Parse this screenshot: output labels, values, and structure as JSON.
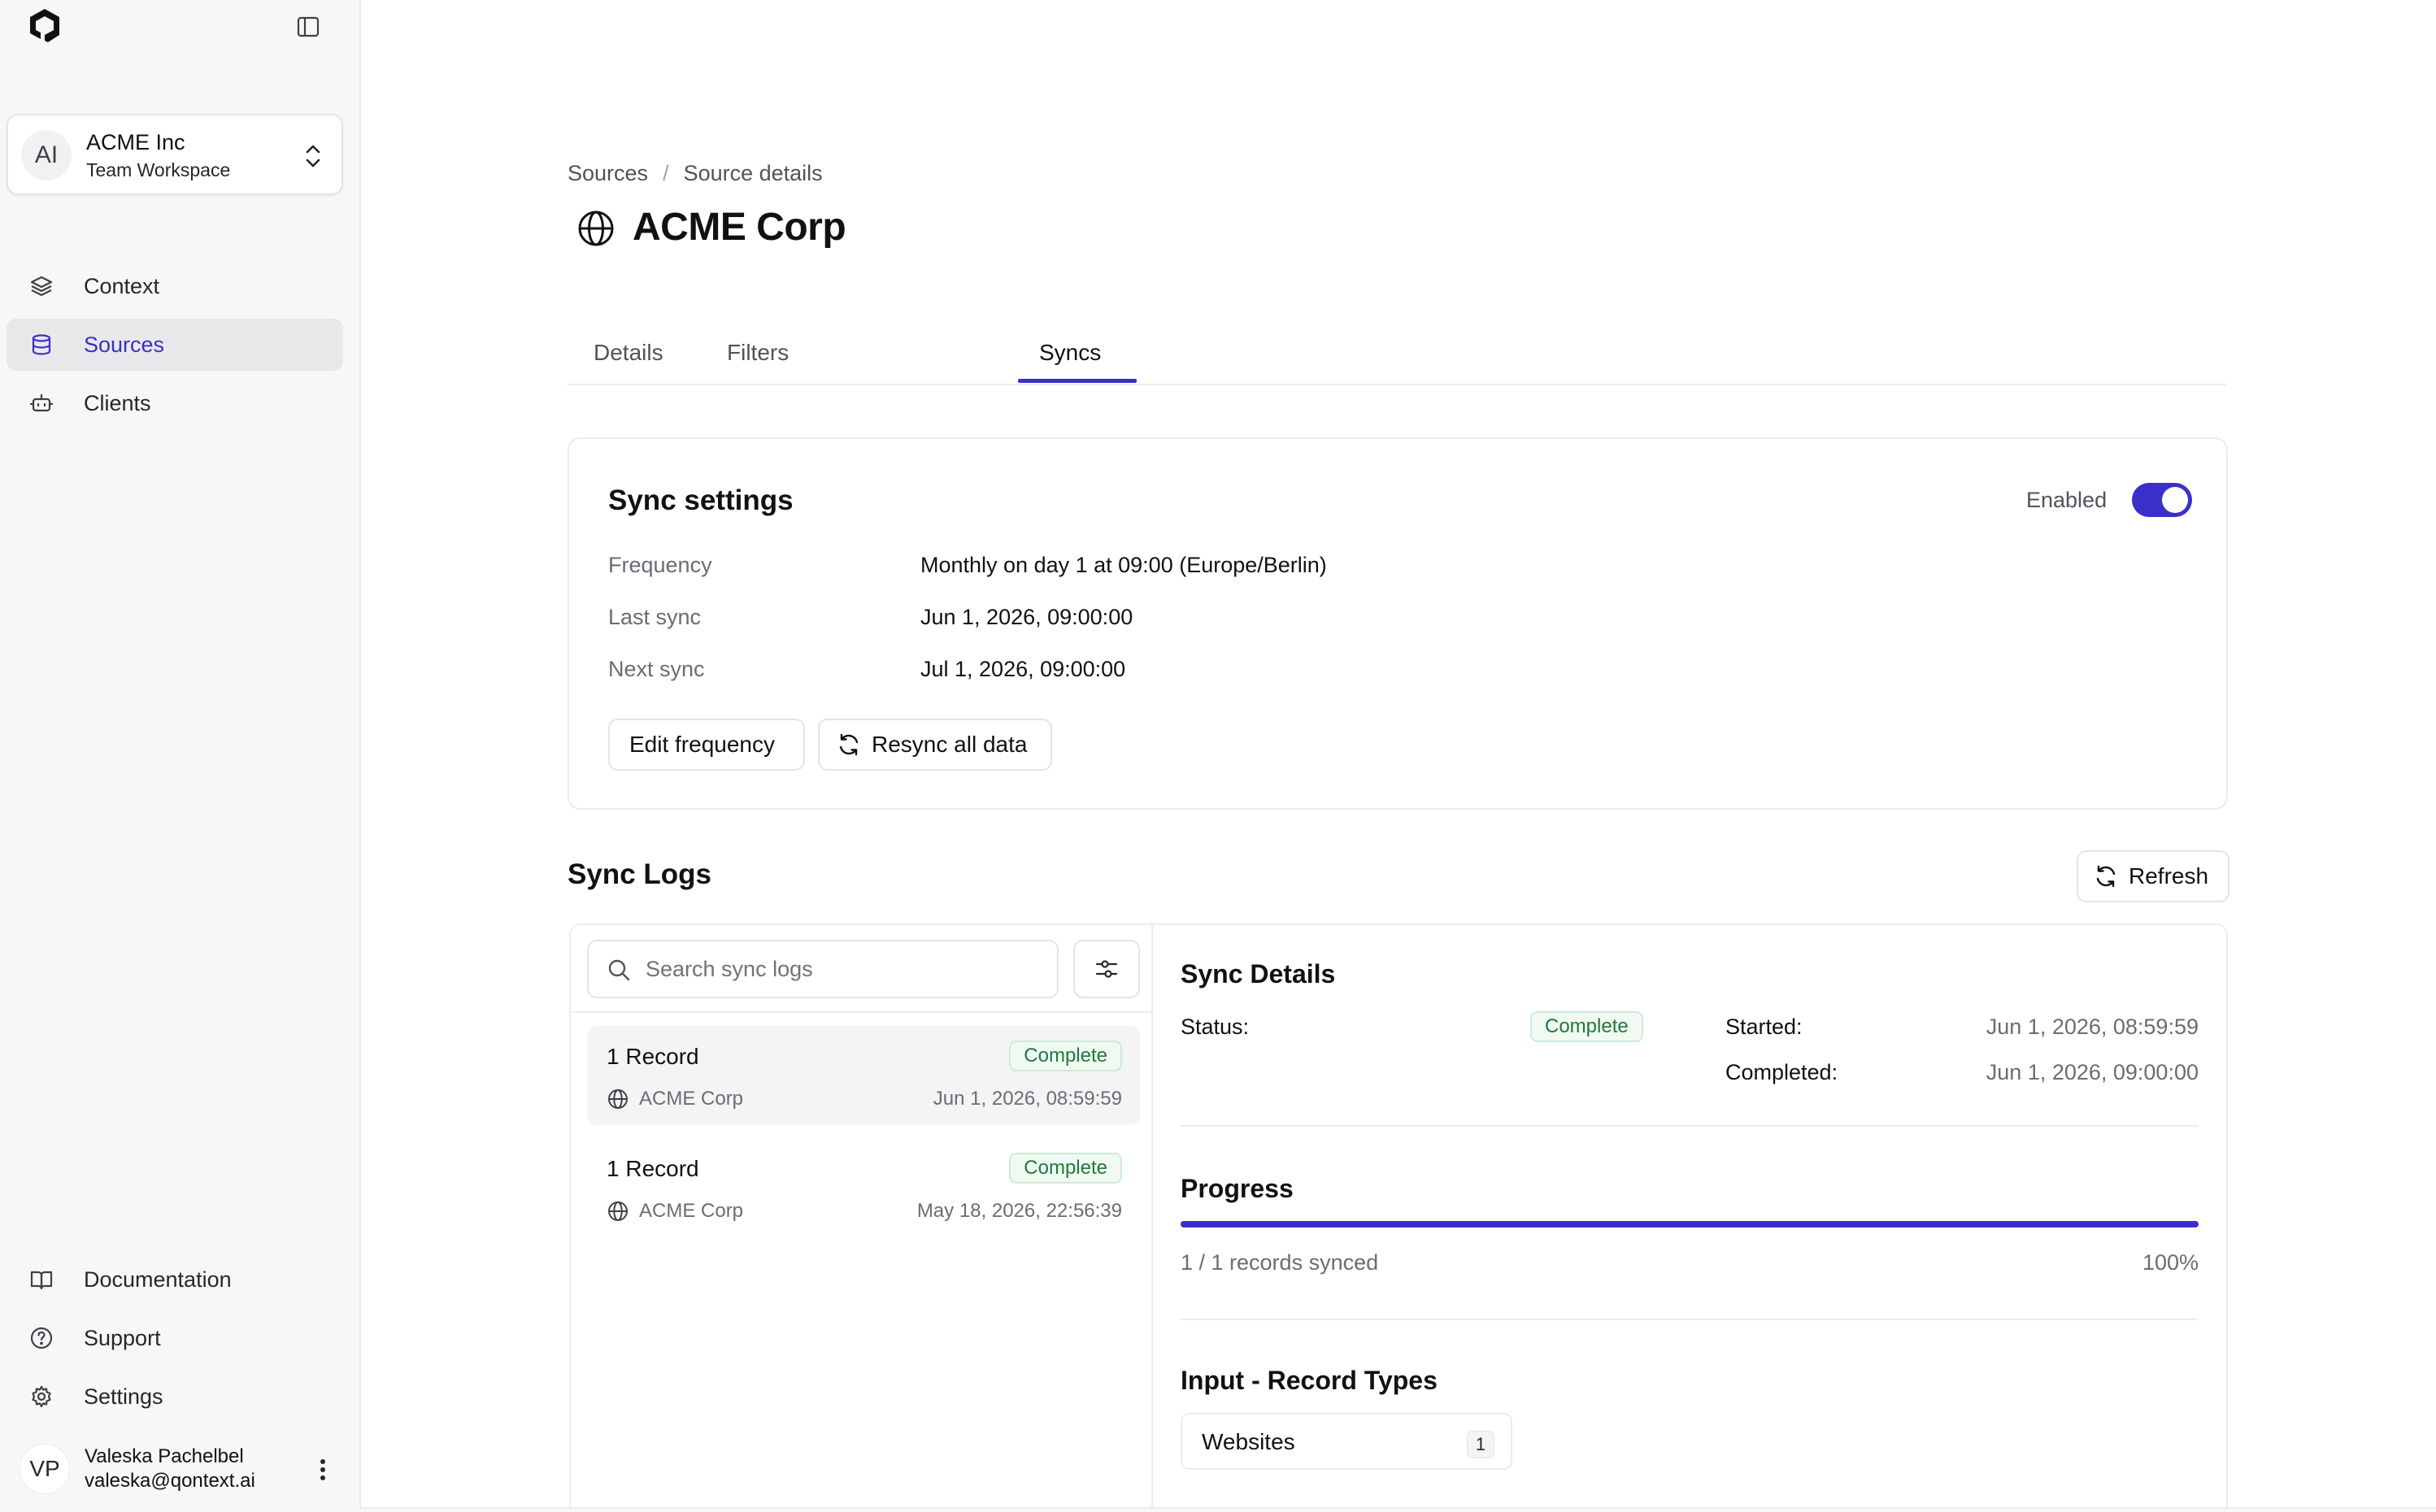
{
  "workspace": {
    "initials": "AI",
    "name": "ACME Inc",
    "subtitle": "Team Workspace"
  },
  "nav": {
    "items": [
      {
        "label": "Context",
        "icon": "layers-icon"
      },
      {
        "label": "Sources",
        "icon": "database-icon",
        "active": true
      },
      {
        "label": "Clients",
        "icon": "bot-icon"
      }
    ],
    "footer": [
      {
        "label": "Documentation",
        "icon": "book-icon"
      },
      {
        "label": "Support",
        "icon": "help-circle-icon"
      },
      {
        "label": "Settings",
        "icon": "gear-icon"
      }
    ]
  },
  "user": {
    "initials": "VP",
    "name": "Valeska Pachelbel",
    "email": "valeska@qontext.ai"
  },
  "breadcrumb": {
    "root": "Sources",
    "separator": "/",
    "current": "Source details"
  },
  "page": {
    "title": "ACME Corp"
  },
  "tabs": [
    {
      "label": "Details"
    },
    {
      "label": "Filters"
    },
    {
      "label": "Syncs",
      "active": true
    }
  ],
  "sync_settings": {
    "title": "Sync settings",
    "toggle_label": "Enabled",
    "enabled": true,
    "rows": [
      {
        "label": "Frequency",
        "value": "Monthly on day 1 at 09:00 (Europe/Berlin)"
      },
      {
        "label": "Last sync",
        "value": "Jun 1, 2026, 09:00:00"
      },
      {
        "label": "Next sync",
        "value": "Jul 1, 2026, 09:00:00"
      }
    ],
    "edit_button": "Edit frequency",
    "resync_button": "Resync all data"
  },
  "sync_logs": {
    "title": "Sync Logs",
    "refresh_button": "Refresh",
    "search_placeholder": "Search sync logs",
    "items": [
      {
        "title": "1 Record",
        "status": "Complete",
        "source": "ACME Corp",
        "date": "Jun 1, 2026, 08:59:59",
        "selected": true
      },
      {
        "title": "1 Record",
        "status": "Complete",
        "source": "ACME Corp",
        "date": "May 18, 2026, 22:56:39"
      }
    ]
  },
  "sync_details": {
    "title": "Sync Details",
    "status_label": "Status:",
    "status_value": "Complete",
    "started_label": "Started:",
    "started_value": "Jun 1, 2026, 08:59:59",
    "completed_label": "Completed:",
    "completed_value": "Jun 1, 2026, 09:00:00",
    "progress_title": "Progress",
    "progress_text": "1 / 1 records synced",
    "progress_percent": "100%",
    "progress_fraction": 1.0,
    "record_types_title": "Input - Record Types",
    "record_types": [
      {
        "label": "Websites",
        "count": "1"
      }
    ]
  },
  "colors": {
    "accent": "#3b2fc9",
    "success": "#1e7a3c",
    "success_bg": "#f0faf2"
  }
}
